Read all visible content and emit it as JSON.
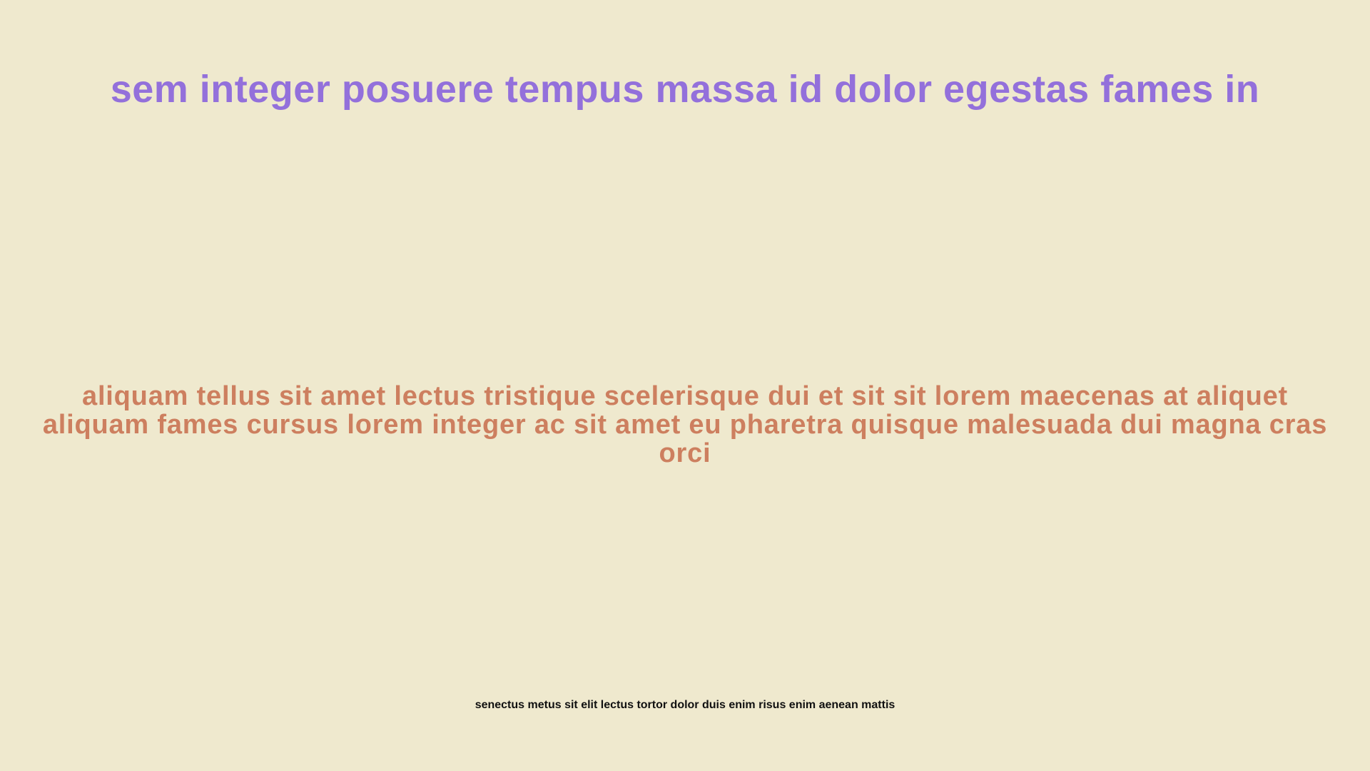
{
  "background_color": "#efe9ce",
  "heading": {
    "text": "sem integer posuere tempus massa id dolor egestas fames in",
    "color": "#9370db"
  },
  "body": {
    "text": "aliquam tellus sit amet lectus tristique scelerisque dui et sit sit lorem maecenas at aliquet aliquam fames cursus lorem integer ac sit amet eu pharetra quisque malesuada dui magna cras orci",
    "color": "#cd7f5f"
  },
  "footer": {
    "text": "senectus metus sit elit lectus tortor dolor duis enim risus enim aenean mattis",
    "color": "#111111"
  }
}
